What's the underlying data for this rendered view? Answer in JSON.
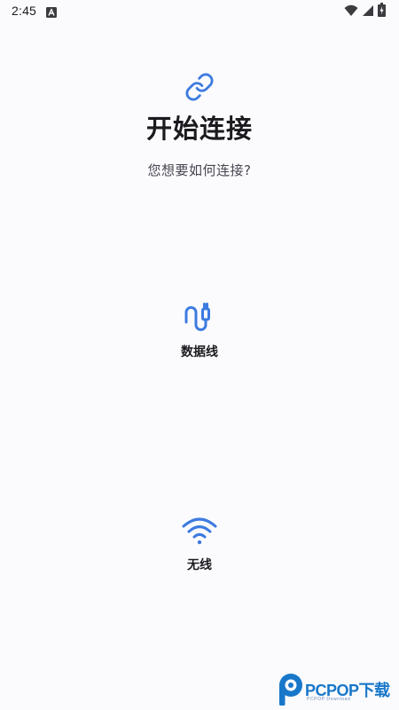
{
  "status_bar": {
    "time": "2:45",
    "notification_icon": "a-notification-icon",
    "wifi_icon": "wifi-icon",
    "signal_icon": "signal-icon",
    "battery_icon": "battery-charging-icon"
  },
  "header": {
    "icon": "link-icon",
    "title": "开始连接",
    "subtitle": "您想要如何连接?"
  },
  "options": [
    {
      "icon": "cable-icon",
      "label": "数据线"
    },
    {
      "icon": "wifi-icon",
      "label": "无线"
    }
  ],
  "colors": {
    "background": "#fbfbfe",
    "accent": "#3d7be0",
    "text": "#1b1b1f"
  },
  "watermark": {
    "text": "PCPOP下载",
    "subtext": "PCPOP Download"
  }
}
